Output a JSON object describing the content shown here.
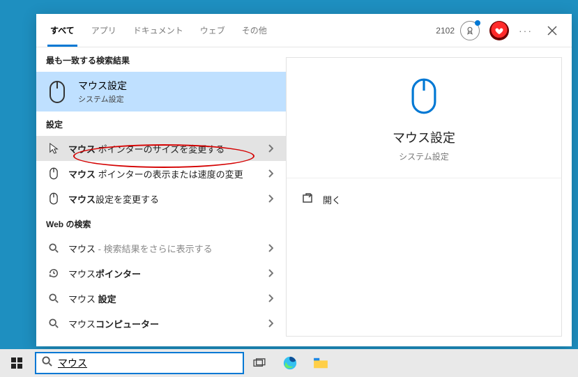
{
  "topbar": {
    "tabs": [
      "すべて",
      "アプリ",
      "ドキュメント",
      "ウェブ",
      "その他"
    ],
    "active_index": 0,
    "points": "2102"
  },
  "left": {
    "best_header": "最も一致する検索結果",
    "best": {
      "title": "マウス設定",
      "sub": "システム設定"
    },
    "settings_header": "設定",
    "settings": [
      {
        "bold": "マウス",
        "rest": " ポインターのサイズを変更する"
      },
      {
        "bold": "マウス",
        "rest": " ポインターの表示または速度の変更"
      },
      {
        "bold": "マウス",
        "rest": "設定を変更する"
      }
    ],
    "web_header": "Web の検索",
    "web": [
      {
        "bold": "マウス",
        "rest": "",
        "hint": " - 検索結果をさらに表示する"
      },
      {
        "bold": "",
        "rest": "マウス",
        "suffix_bold": "ポインター"
      },
      {
        "bold": "",
        "rest": "マウス ",
        "suffix_bold": "設定"
      },
      {
        "bold": "",
        "rest": "マウス",
        "suffix_bold": "コンピューター"
      }
    ]
  },
  "right": {
    "title": "マウス設定",
    "sub": "システム設定",
    "open_label": "開く"
  },
  "search_value": "マウス"
}
